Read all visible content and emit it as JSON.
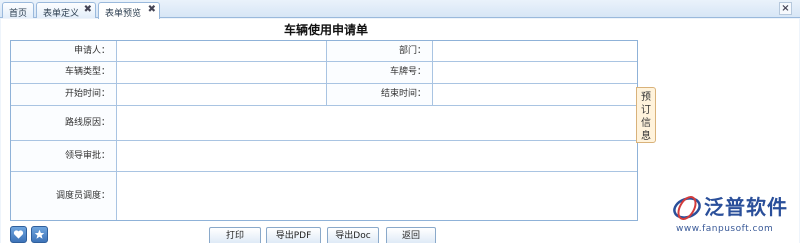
{
  "tabs": [
    {
      "label": "首页",
      "closable": false
    },
    {
      "label": "表单定义",
      "closable": true
    },
    {
      "label": "表单预览",
      "closable": true,
      "active": true
    }
  ],
  "tab_close_glyph": "✖",
  "close_all_glyph": "×",
  "form": {
    "title": "车辆使用申请单",
    "fields": {
      "applicant": "申请人：",
      "department": "部门：",
      "vehicle_type": "车辆类型：",
      "plate_no": "车牌号：",
      "start_time": "开始时间：",
      "end_time": "结束时间：",
      "route_reason": "路线原因：",
      "leader_approval": "领导审批：",
      "dispatcher": "调度员调度："
    },
    "side_tab": "预订信息"
  },
  "buttons": {
    "print": "打印",
    "export_pdf": "导出PDF",
    "export_doc": "导出Doc",
    "back": "返回"
  },
  "brand": {
    "name": "泛普软件",
    "url": "www.fanpusoft.com",
    "color": "#2a4f9a"
  },
  "icons": [
    "heart-icon",
    "star-icon",
    "close-icon"
  ]
}
